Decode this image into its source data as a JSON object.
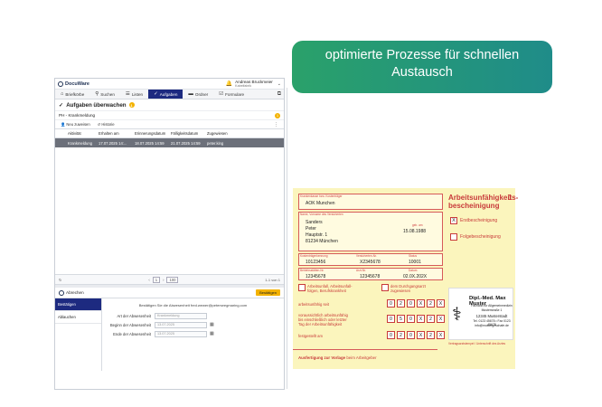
{
  "app": {
    "logo": "DocuWare",
    "user_name": "Andreas Bruckmeier",
    "user_org": "Kabelfabrik",
    "nav": [
      {
        "label": "Briefkörbe",
        "icon": "inbox-icon",
        "glyph": "⌂"
      },
      {
        "label": "Suchen",
        "icon": "search-icon",
        "glyph": "⚲"
      },
      {
        "label": "Listen",
        "icon": "list-icon",
        "glyph": "☰"
      },
      {
        "label": "Aufgaben",
        "icon": "check-icon",
        "glyph": "✓"
      },
      {
        "label": "Ordner",
        "icon": "folder-icon",
        "glyph": "▬"
      },
      {
        "label": "Formulare",
        "icon": "form-icon",
        "glyph": "☑"
      }
    ],
    "page_title": "Aufgaben überwachen",
    "page_badge": "1",
    "section_title": "PH - Krankmeldung",
    "section_badge": "1",
    "toolbar": {
      "assign": "Neu zuweisen",
      "history": "Historie"
    },
    "table": {
      "headers": [
        "Aktivität",
        "Erhalten am",
        "Erinnerungsdatum",
        "Fälligkeitsdatum",
        "Zugewiesen"
      ],
      "rows": [
        [
          "Krankmeldung",
          "17.07.2025 14:...",
          "18.07.2025 14:59",
          "21.07.2025 14:59",
          "peter.king"
        ]
      ]
    },
    "pager": {
      "page": "1",
      "per_page": "100",
      "count": "1-1 von 1"
    },
    "bottom": {
      "header": "Abrechen",
      "confirm": "Bestätigen",
      "side_items": [
        "Bestätigen",
        "Ablauchen"
      ],
      "info": "Bestätigen Sie die Abwesenheit fred.wewer@peterseegmaring.com",
      "fields": [
        {
          "label": "Art der Abwesenheit",
          "value": "Krankmeldung",
          "cal": false
        },
        {
          "label": "Beginn der Abwesenheit",
          "value": "13.07.2025",
          "cal": true
        },
        {
          "label": "Ende der Abwesenheit",
          "value": "13.07.2025",
          "cal": true
        }
      ]
    }
  },
  "banner": {
    "line1": "optimierte Prozesse für schnellen",
    "line2": "Austausch"
  },
  "note": {
    "insurance_label": "Krankenkasse bzw. Kostenträger",
    "insurance": "AOK Munchen",
    "name_label": "Name, Vorname des Versicherten",
    "last_name": "Sanders",
    "first_name": "Peter",
    "street": "Hauptstr. 1",
    "city": "81234 München",
    "dob_label": "geb. am",
    "dob": "15.08.1988",
    "cost_label": "Kostenträgerkennung",
    "cost": "10123456",
    "insured_no_label": "Versicherten-Nr.",
    "insured_no": "X2345678",
    "status_label": "Status",
    "status": "10001",
    "office_label": "Betriebsstätten-Nr.",
    "office": "12345678",
    "doctor_no_label": "Arzt-Nr.",
    "doctor_no": "12345678",
    "date_label": "Datum",
    "date": "02.0X.202X",
    "title_line1": "Arbeitsunfähigkeits-",
    "title_line2": "bescheinigung",
    "title_num": "1",
    "first_cert": "Erstbescheinigung",
    "first_mark": "X",
    "follow_cert": "Folgebescheinigung",
    "accident": "Arbeitsunfall, Arbeitsunfall-\nfolgen, Berufskrankheit",
    "doctor_assigned": "dem Durchgangsarzt\nzugewiesen",
    "since_label": "arbeitsunfähig seit",
    "since_digits": [
      "0",
      "2",
      "0",
      "X",
      "2",
      "X"
    ],
    "until_label": "voraussichtlich arbeitsunfähig\nbis einschließlich oder letzter\nTag der Arbeitsunfähigkeit",
    "until_digits": [
      "0",
      "5",
      "0",
      "X",
      "2",
      "X"
    ],
    "found_label": "festgestellt am",
    "found_digits": [
      "0",
      "2",
      "0",
      "X",
      "2",
      "X"
    ],
    "doctor_name": "Dipl.-Med. Max Muster",
    "doctor_lines": [
      "Facharzt für Allgemeinmedizin",
      "Musterstraße 1",
      "12345 Musterstadt",
      "Tel. 0123 45678 • Fax 0123 45678",
      "info@mustergeschafe.de"
    ],
    "stamp_label": "Vertragsarztstempel / Unterschrift des Arztes",
    "footer_bold": "Ausfertigung zur Vorlage",
    "footer_rest": "beim Arbeitgeber"
  }
}
